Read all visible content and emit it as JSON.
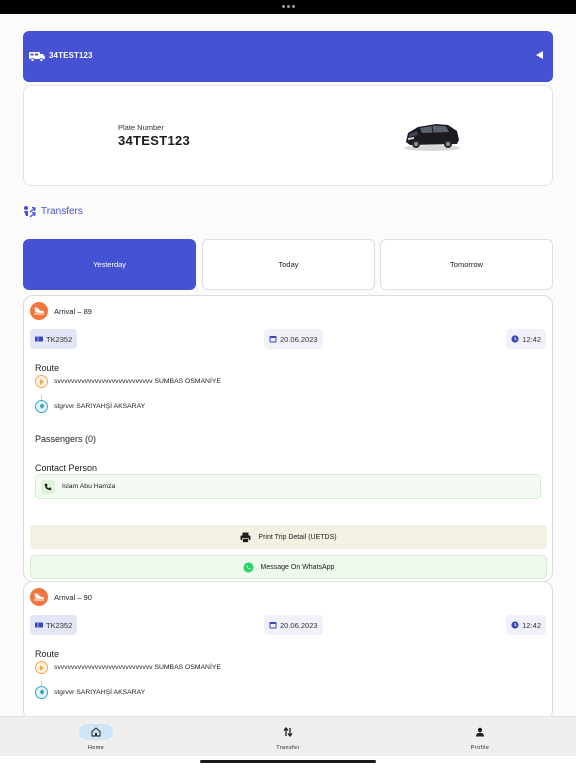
{
  "vehicle": {
    "header_plate": "34TEST123",
    "plate_label": "Plate Number",
    "plate_value": "34TEST123"
  },
  "transfers_title": "Transfers",
  "tabs": [
    {
      "label": "Yesterday",
      "active": true
    },
    {
      "label": "Today",
      "active": false
    },
    {
      "label": "Tomorrow",
      "active": false
    }
  ],
  "transfers": [
    {
      "arrival": "Arrival – 89",
      "flight": "TK2352",
      "date": "20.06.2023",
      "time": "12:42",
      "route_label": "Route",
      "from": "svvvvvvvvvvvvvvvvvvvvvvvvvvvv SUMBAS OSMANİYE",
      "to": "stgrvvr SARIYAHŞİ AKSARAY",
      "passengers_label": "Passengers (0)",
      "contact_label": "Contact Person",
      "contact_name": "Islam Abu Hamza",
      "print_label": "Print Trip Detail (UETDS)",
      "whatsapp_label": "Message On WhatsApp"
    },
    {
      "arrival": "Arrival – 90",
      "flight": "TK2352",
      "date": "20.06.2023",
      "time": "12:42",
      "route_label": "Route",
      "from": "svvvvvvvvvvvvvvvvvvvvvvvvvvvv SUMBAS OSMANİYE",
      "to": "stgrvvr SARIYAHŞİ AKSARAY"
    }
  ],
  "nav": [
    {
      "label": "Home",
      "icon": "home-icon",
      "active": true
    },
    {
      "label": "Transfer",
      "icon": "transfer-arrows-icon",
      "active": false
    },
    {
      "label": "Profile",
      "icon": "person-icon",
      "active": false
    }
  ],
  "colors": {
    "primary": "#4552d3",
    "arrival_badge": "#f4763e",
    "route_start": "#f0a64a",
    "route_end": "#31a7c8",
    "whatsapp": "#25d366"
  }
}
